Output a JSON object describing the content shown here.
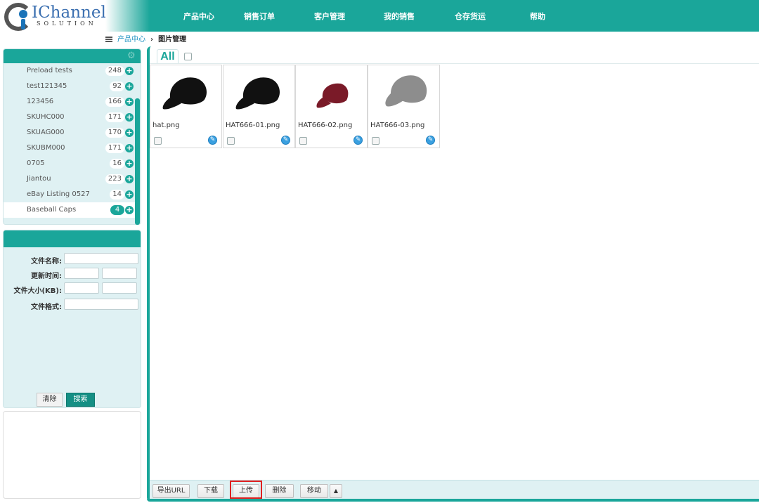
{
  "header": {
    "logo_text": "IChannel",
    "logo_subtext": "SOLUTION",
    "nav": [
      "产品中心",
      "销售订单",
      "客户管理",
      "我的销售",
      "仓存货运",
      "帮助"
    ]
  },
  "breadcrumb": {
    "parent": "产品中心",
    "separator": "›",
    "current": "图片管理"
  },
  "categories": [
    {
      "label": "Preload tests",
      "count": "248"
    },
    {
      "label": "test121345",
      "count": "92"
    },
    {
      "label": "123456",
      "count": "166"
    },
    {
      "label": "SKUHC000",
      "count": "171"
    },
    {
      "label": "SKUAG000",
      "count": "170"
    },
    {
      "label": "SKUBM000",
      "count": "171"
    },
    {
      "label": "0705",
      "count": "16"
    },
    {
      "label": "Jiantou",
      "count": "223"
    },
    {
      "label": "eBay Listing 0527",
      "count": "14"
    },
    {
      "label": "Baseball Caps",
      "count": "4",
      "selected": true
    }
  ],
  "filter": {
    "file_name_label": "文件名称:",
    "update_time_label": "更新时间:",
    "file_size_label": "文件大小(KB):",
    "file_format_label": "文件格式:",
    "clear_label": "清除",
    "search_label": "搜索"
  },
  "gallery": {
    "tab_label": "All",
    "images": [
      {
        "name": "hat.png",
        "color": "#111111"
      },
      {
        "name": "HAT666-01.png",
        "color": "#111111"
      },
      {
        "name": "HAT666-02.png",
        "color": "#7a1a28"
      },
      {
        "name": "HAT666-03.png",
        "color": "#8d8d8d"
      }
    ]
  },
  "toolbar": {
    "export_url": "导出URL",
    "download": "下载",
    "upload": "上传",
    "delete": "删除",
    "move": "移动",
    "more_arrow": "▲"
  },
  "colors": {
    "accent": "#1aa69a",
    "panel_bg": "#dff1f3",
    "highlight_frame": "#e02020"
  }
}
